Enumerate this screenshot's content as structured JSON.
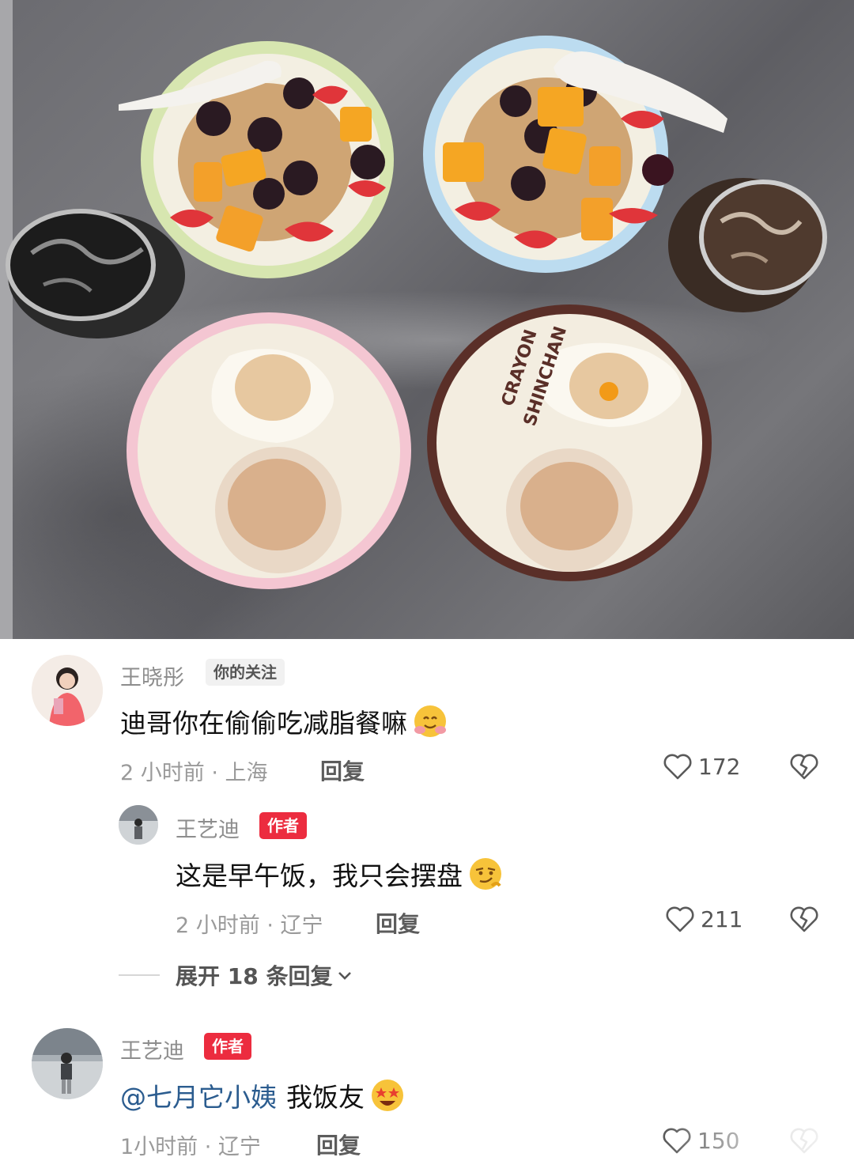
{
  "photo": {
    "icon": "food-photo",
    "plate_print": [
      "CRAYON",
      "SHINCHAN"
    ]
  },
  "comments": [
    {
      "name": "王晓彤",
      "badge": "你的关注",
      "text": "迪哥你在偷偷吃减脂餐嘛",
      "emoji": "hugging-face-emoji",
      "time_location": "2 小时前 · 上海",
      "reply_label": "回复",
      "likes": "172"
    },
    {
      "name": "王艺迪",
      "badge": "作者",
      "text": "这是早午饭，我只会摆盘",
      "emoji": "smirking-face-emoji",
      "time_location": "2 小时前 · 辽宁",
      "reply_label": "回复",
      "likes": "211",
      "expand_label": "展开 18 条回复"
    },
    {
      "name": "王艺迪",
      "badge": "作者",
      "mention": "@七月它小姨",
      "text": "我饭友",
      "emoji": "star-struck-emoji",
      "time_location": "1小时前 · 辽宁",
      "reply_label": "回复",
      "likes": "150"
    }
  ],
  "colors": {
    "author_badge": "#ec2c3f",
    "mention": "#2b5c8f"
  }
}
